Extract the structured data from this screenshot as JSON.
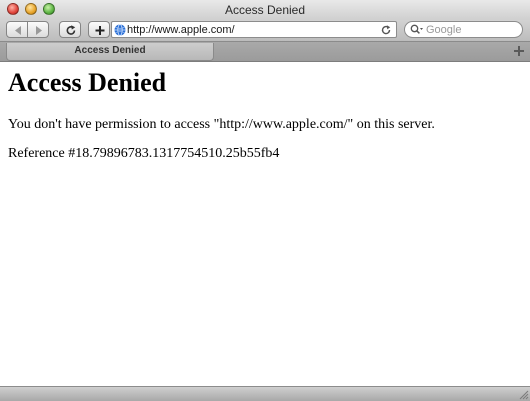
{
  "window": {
    "title": "Access Denied"
  },
  "toolbar": {
    "back_icon": "back-arrow-icon",
    "forward_icon": "forward-arrow-icon",
    "reload_icon": "reload-icon",
    "add_icon": "plus-icon",
    "address": {
      "value": "http://www.apple.com/",
      "site_icon": "globe-icon"
    },
    "search": {
      "placeholder": "Google",
      "icon": "magnifier-icon"
    }
  },
  "tabs": {
    "items": [
      {
        "label": "Access Denied",
        "active": true
      }
    ],
    "new_tab_icon": "plus-icon"
  },
  "page": {
    "heading": "Access Denied",
    "message": "You don't have permission to access \"http://www.apple.com/\" on this server.",
    "reference": "Reference #18.79896783.1317754510.25b55fb4"
  },
  "colors": {
    "close": "#e0443b",
    "minimize": "#e8a42a",
    "zoom": "#5cb443",
    "globe": "#2a6fd6"
  }
}
